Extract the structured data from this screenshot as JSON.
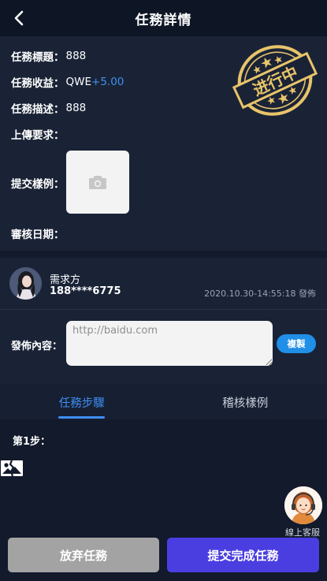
{
  "header": {
    "title": "任務詳情",
    "back_icon": "chevron-left-icon"
  },
  "task": {
    "title_label": "任務標題：",
    "title_value": "888",
    "reward_label": "任務收益：",
    "reward_currency": "QWE",
    "reward_amount": "+5.00",
    "desc_label": "任務描述：",
    "desc_value": "888",
    "upload_req_label": "上傳要求：",
    "sample_label": "提交樣例：",
    "sample_icon": "camera-icon",
    "review_date_label": "審核日期：",
    "stamp_text": "进行中"
  },
  "publisher": {
    "name": "需求方",
    "phone": "188****6775",
    "date": "2020.10.30-14:55:18 發佈",
    "content_label": "發佈內容：",
    "content_placeholder": "http://baidu.com",
    "copy_label": "複製"
  },
  "tabs": [
    {
      "label": "任務步驟",
      "active": true
    },
    {
      "label": "稽核樣例",
      "active": false
    }
  ],
  "steps": {
    "step1_label": "第1步：",
    "image_icon": "broken-image-icon"
  },
  "service": {
    "label": "線上客服",
    "icon": "customer-service-icon"
  },
  "actions": {
    "abandon_label": "放弃任務",
    "submit_label": "提交完成任務"
  },
  "colors": {
    "background": "#121a2b",
    "card": "#1a2336",
    "accent_blue": "#3f8ef3",
    "stamp_gold": "#e8c46a",
    "submit_purple": "#4a3ee0",
    "abandon_gray": "#a3a3a3"
  }
}
